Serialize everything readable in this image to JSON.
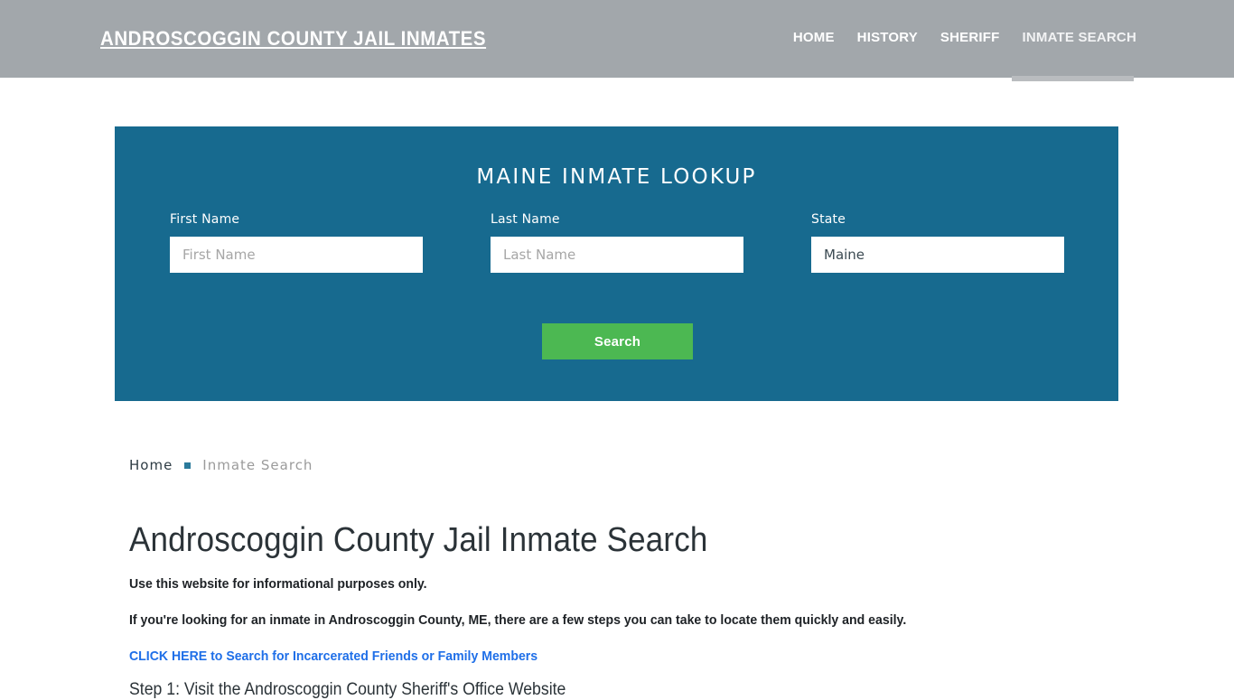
{
  "header": {
    "brand": "ANDROSCOGGIN COUNTY JAIL INMATES",
    "nav": [
      {
        "label": "HOME",
        "active": false
      },
      {
        "label": "HISTORY",
        "active": false
      },
      {
        "label": "SHERIFF",
        "active": false
      },
      {
        "label": "INMATE SEARCH",
        "active": true
      }
    ],
    "bg_color": "#a2a7ab",
    "active_bar_color": "#b9bcbf"
  },
  "lookup": {
    "title": "MAINE INMATE LOOKUP",
    "panel_color": "#176a8f",
    "fields": [
      {
        "label": "First Name",
        "placeholder": "First Name",
        "value": ""
      },
      {
        "label": "Last Name",
        "placeholder": "Last Name",
        "value": ""
      }
    ],
    "state": {
      "label": "State",
      "selected": "Maine",
      "options": [
        "Maine"
      ]
    },
    "search_label": "Search",
    "search_color": "#4cb852"
  },
  "breadcrumb": {
    "home": "Home",
    "separator": "•",
    "current": "Inmate Search",
    "bullet_color": "#2b7a9b"
  },
  "main": {
    "title": "Androscoggin County Jail Inmate Search",
    "intro": "Use this website for informational purposes only.",
    "lead": "If you're looking for an inmate in Androscoggin County, ME, there are a few steps you can take to locate them quickly and easily.",
    "cta": "CLICK HERE to Search for Incarcerated Friends or Family Members",
    "cta_color": "#1f6fe8",
    "step": "Step 1: Visit the Androscoggin County Sheriff's Office Website"
  }
}
